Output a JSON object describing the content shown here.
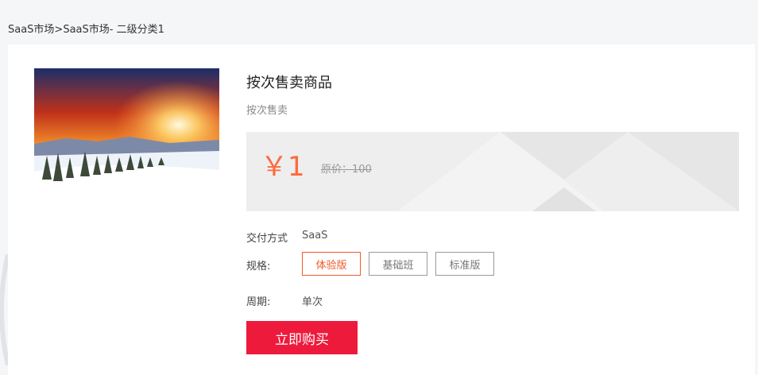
{
  "breadcrumb": "SaaS市场>SaaS市场- 二级分类1",
  "product": {
    "title": "按次售卖商品",
    "subtitle": "按次售卖",
    "image_icon": "winter-sunset-photo",
    "price": "￥1",
    "original_price": "原价：100"
  },
  "delivery": {
    "label": "交付方式",
    "value": "SaaS"
  },
  "spec": {
    "label": "规格:",
    "options": [
      "体验版",
      "基础班",
      "标准版"
    ],
    "selected": "体验版"
  },
  "period": {
    "label": "周期:",
    "value": "单次"
  },
  "buy_label": "立即购买",
  "colors": {
    "accent": "#ff6a3d",
    "buy": "#ee1a3c",
    "selected_border": "#ee5a2a"
  }
}
